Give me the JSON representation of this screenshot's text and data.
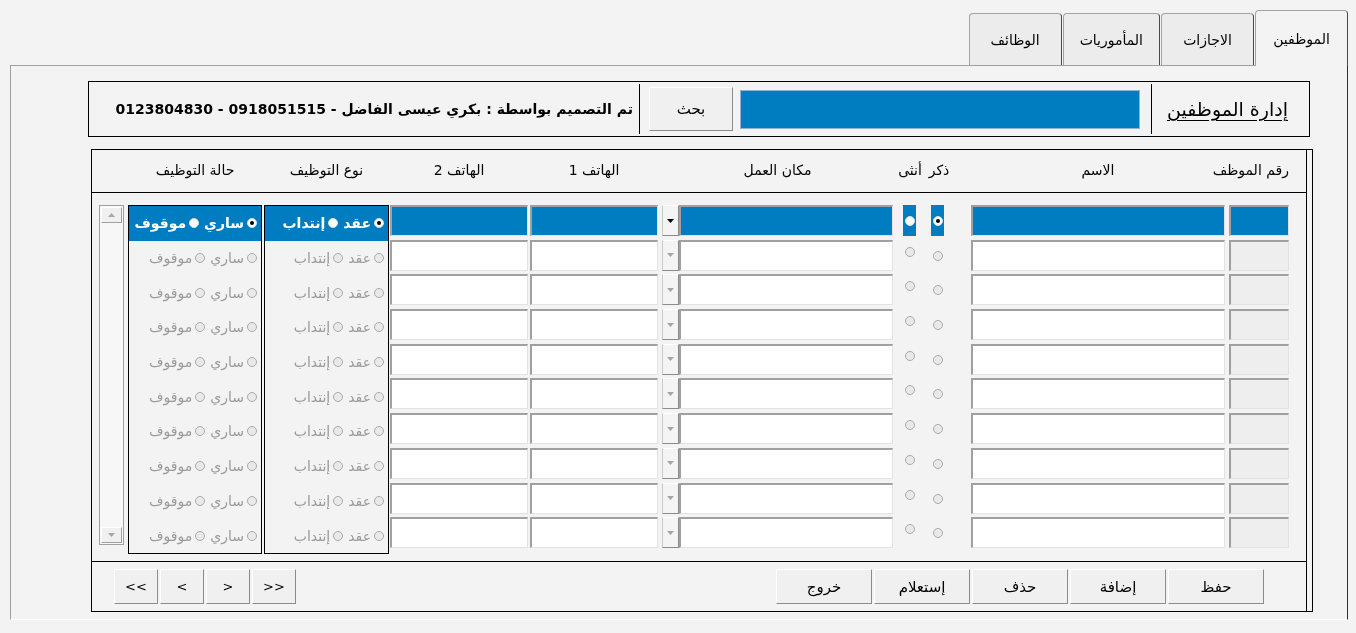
{
  "tabs": [
    {
      "label": "الموظفين",
      "selected": true
    },
    {
      "label": "الاجازات",
      "selected": false
    },
    {
      "label": "المأموريات",
      "selected": false
    },
    {
      "label": "الوظائف",
      "selected": false
    }
  ],
  "header": {
    "title": "إدارة الموظفين",
    "search_button": "بحث",
    "credit": "تم التصميم بواسطة : بكري عيسى الفاضل - 0918051515 - 0123804830"
  },
  "table": {
    "columns": [
      "رقم الموظف",
      "الاسم",
      "ذكر",
      "أنثى",
      "مكان العمل",
      "الهاتف 1",
      "الهاتف 2",
      "نوع التوظيف",
      "حالة التوظيف"
    ],
    "rows": [
      {
        "selected": true,
        "disabled": false,
        "male_checked": true,
        "female_checked": false,
        "employment_type": [
          {
            "label": "عقد",
            "checked": true
          },
          {
            "label": "إنتداب",
            "checked": false
          }
        ],
        "employment_status": [
          {
            "label": "ساري",
            "checked": true
          },
          {
            "label": "موقوف",
            "checked": false
          }
        ]
      },
      {
        "selected": false,
        "disabled": true,
        "male_checked": false,
        "female_checked": false,
        "employment_type": [
          {
            "label": "عقد",
            "checked": false
          },
          {
            "label": "إنتداب",
            "checked": false
          }
        ],
        "employment_status": [
          {
            "label": "ساري",
            "checked": false
          },
          {
            "label": "موقوف",
            "checked": false
          }
        ]
      },
      {
        "selected": false,
        "disabled": true,
        "male_checked": false,
        "female_checked": false,
        "employment_type": [
          {
            "label": "عقد",
            "checked": false
          },
          {
            "label": "إنتداب",
            "checked": false
          }
        ],
        "employment_status": [
          {
            "label": "ساري",
            "checked": false
          },
          {
            "label": "موقوف",
            "checked": false
          }
        ]
      },
      {
        "selected": false,
        "disabled": true,
        "male_checked": false,
        "female_checked": false,
        "employment_type": [
          {
            "label": "عقد",
            "checked": false
          },
          {
            "label": "إنتداب",
            "checked": false
          }
        ],
        "employment_status": [
          {
            "label": "ساري",
            "checked": false
          },
          {
            "label": "موقوف",
            "checked": false
          }
        ]
      },
      {
        "selected": false,
        "disabled": true,
        "male_checked": false,
        "female_checked": false,
        "employment_type": [
          {
            "label": "عقد",
            "checked": false
          },
          {
            "label": "إنتداب",
            "checked": false
          }
        ],
        "employment_status": [
          {
            "label": "ساري",
            "checked": false
          },
          {
            "label": "موقوف",
            "checked": false
          }
        ]
      },
      {
        "selected": false,
        "disabled": true,
        "male_checked": false,
        "female_checked": false,
        "employment_type": [
          {
            "label": "عقد",
            "checked": false
          },
          {
            "label": "إنتداب",
            "checked": false
          }
        ],
        "employment_status": [
          {
            "label": "ساري",
            "checked": false
          },
          {
            "label": "موقوف",
            "checked": false
          }
        ]
      },
      {
        "selected": false,
        "disabled": true,
        "male_checked": false,
        "female_checked": false,
        "employment_type": [
          {
            "label": "عقد",
            "checked": false
          },
          {
            "label": "إنتداب",
            "checked": false
          }
        ],
        "employment_status": [
          {
            "label": "ساري",
            "checked": false
          },
          {
            "label": "موقوف",
            "checked": false
          }
        ]
      },
      {
        "selected": false,
        "disabled": true,
        "male_checked": false,
        "female_checked": false,
        "employment_type": [
          {
            "label": "عقد",
            "checked": false
          },
          {
            "label": "إنتداب",
            "checked": false
          }
        ],
        "employment_status": [
          {
            "label": "ساري",
            "checked": false
          },
          {
            "label": "موقوف",
            "checked": false
          }
        ]
      },
      {
        "selected": false,
        "disabled": true,
        "male_checked": false,
        "female_checked": false,
        "employment_type": [
          {
            "label": "عقد",
            "checked": false
          },
          {
            "label": "إنتداب",
            "checked": false
          }
        ],
        "employment_status": [
          {
            "label": "ساري",
            "checked": false
          },
          {
            "label": "موقوف",
            "checked": false
          }
        ]
      },
      {
        "selected": false,
        "disabled": true,
        "male_checked": false,
        "female_checked": false,
        "employment_type": [
          {
            "label": "عقد",
            "checked": false
          },
          {
            "label": "إنتداب",
            "checked": false
          }
        ],
        "employment_status": [
          {
            "label": "ساري",
            "checked": false
          },
          {
            "label": "موقوف",
            "checked": false
          }
        ]
      }
    ]
  },
  "buttons": [
    "حفظ",
    "إضافة",
    "حذف",
    "إستعلام",
    "خروج"
  ],
  "navigation": [
    ">>",
    ">",
    "<",
    "<<"
  ]
}
